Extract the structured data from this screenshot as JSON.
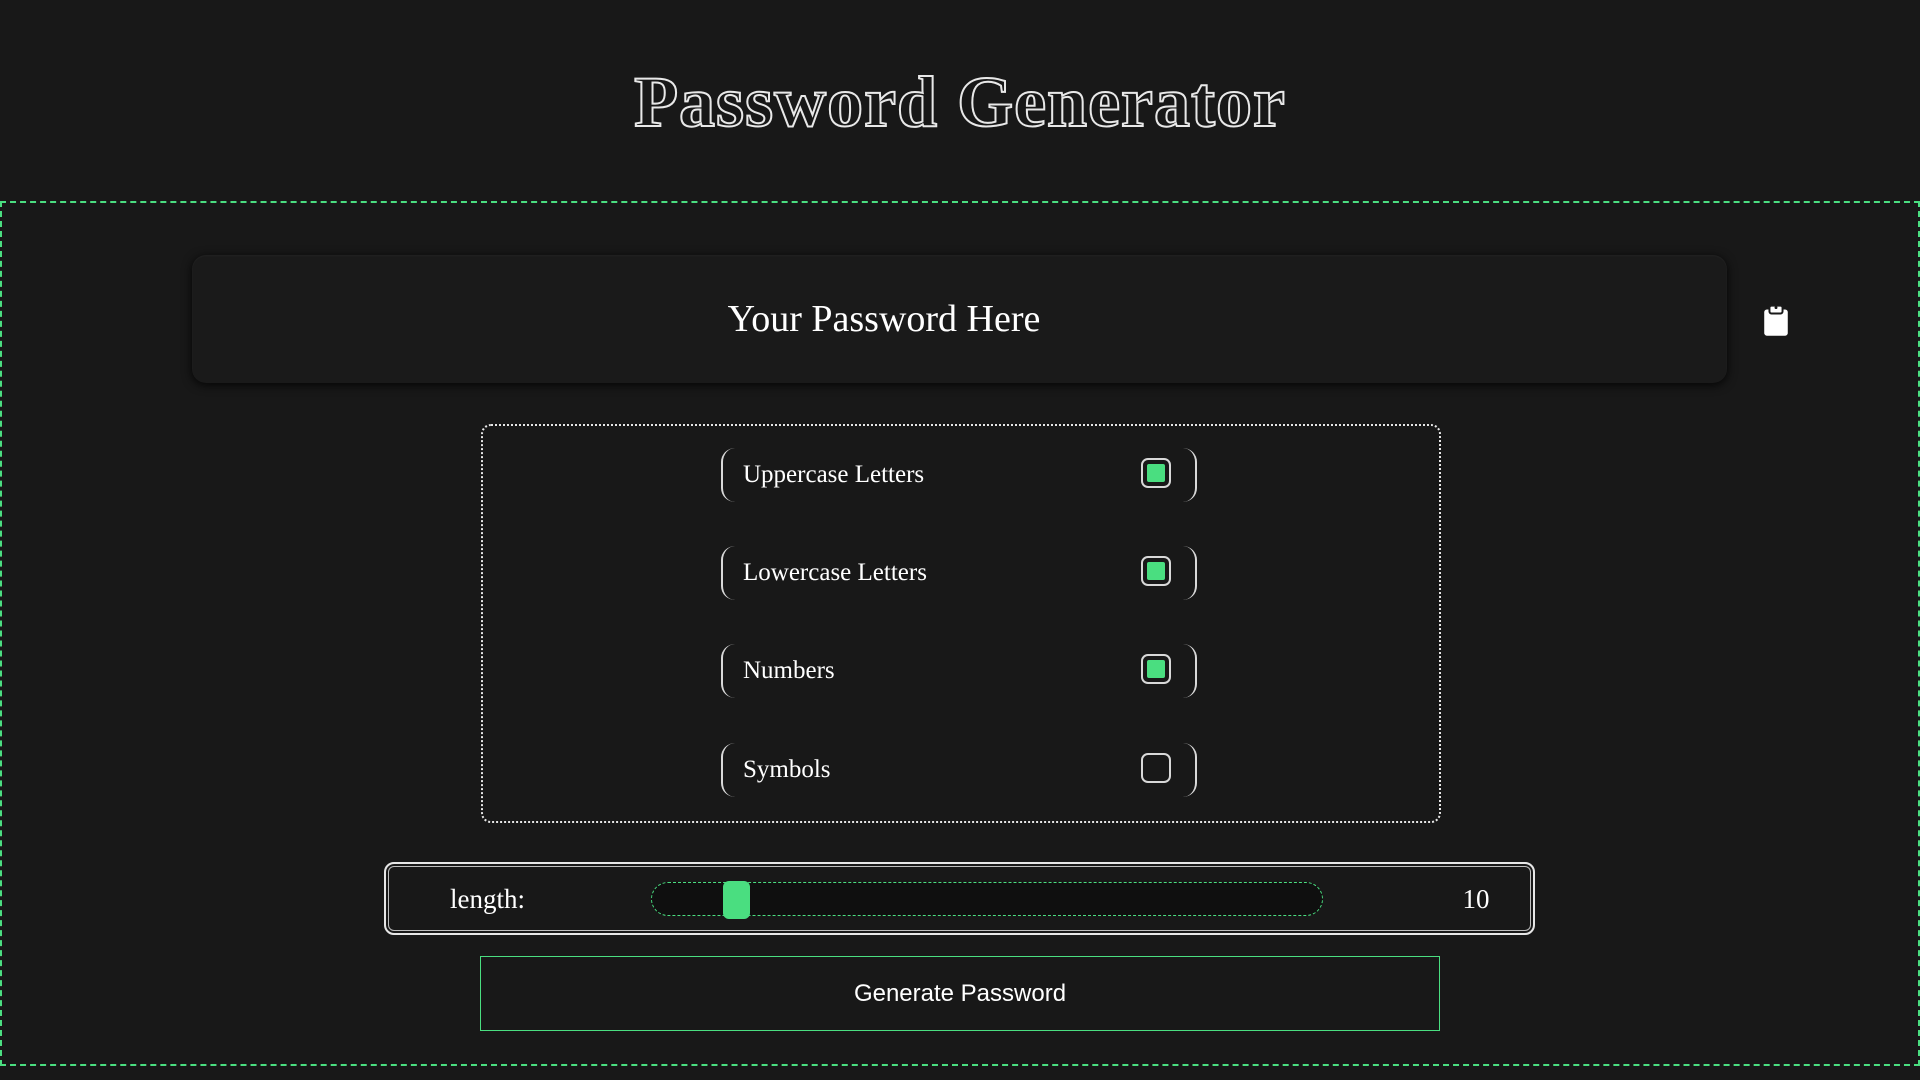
{
  "header": {
    "title": "Password Generator"
  },
  "password": {
    "display_text": "Your Password Here",
    "copy_icon": "clipboard-icon"
  },
  "options": [
    {
      "label": "Uppercase Letters",
      "checked": true
    },
    {
      "label": "Lowercase Letters",
      "checked": true
    },
    {
      "label": "Numbers",
      "checked": true
    },
    {
      "label": "Symbols",
      "checked": false
    }
  ],
  "length": {
    "label": "length:",
    "value": "10",
    "slider_fraction": 0.08
  },
  "actions": {
    "generate_label": "Generate Password"
  },
  "colors": {
    "background": "#181818",
    "accent": "#4ade80",
    "text": "#ffffff",
    "border": "#e6e6e6"
  }
}
